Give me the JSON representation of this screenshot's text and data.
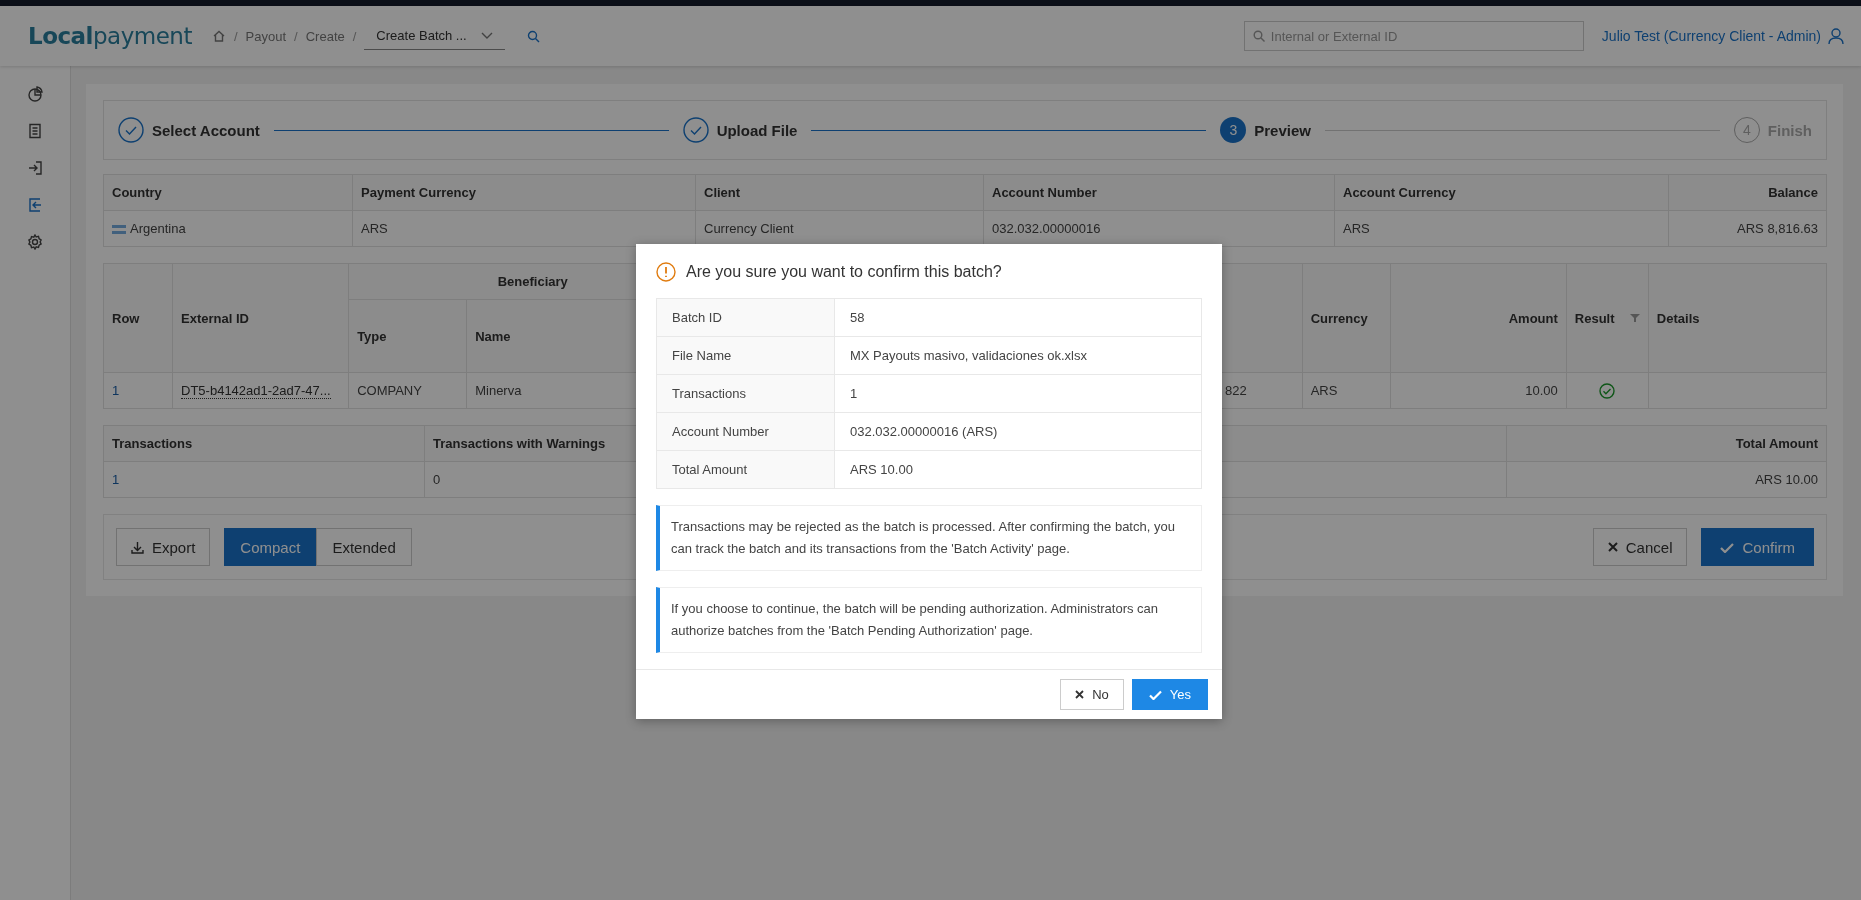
{
  "header": {
    "logo": "**Local**payment",
    "breadcrumb": [
      {
        "separator": "/",
        "label": "Payout"
      },
      {
        "separator": "/",
        "label": "Create"
      }
    ],
    "trailing_separator": "/",
    "page_select": "Create Batch ...",
    "search": {
      "placeholder": "Internal or External ID"
    },
    "user": "Julio Test (Currency Client - Admin)"
  },
  "sidebar": {
    "items": [
      {
        "selected": false
      },
      {
        "selected": false
      },
      {
        "selected": false
      },
      {
        "selected": true
      },
      {
        "selected": false
      }
    ]
  },
  "steps": [
    {
      "label": "Select Account",
      "kind": "done"
    },
    {
      "label": "Upload File",
      "kind": "done"
    },
    {
      "label": "Preview",
      "kind": "current",
      "number": "3"
    },
    {
      "label": "Finish",
      "kind": "pending",
      "number": "4"
    }
  ],
  "account_table": {
    "columns": [
      "Country",
      "Payment Currency",
      "Client",
      "Account Number",
      "Account Currency",
      "Balance"
    ],
    "rows": [
      [
        "Argentina",
        "ARS",
        "Currency Client",
        "032.032.00000016",
        "ARS",
        "ARS 8,816.63"
      ]
    ]
  },
  "transactions_table": {
    "group_header": "Beneficiary",
    "columns": [
      "Row",
      "External ID",
      "Type",
      "Name",
      "",
      "Currency",
      "Amount",
      "Result",
      "Details"
    ],
    "rows": [
      {
        "row": "1",
        "external_id": "DT5-b4142ad1-2ad7-47...",
        "type": "COMPANY",
        "name": "Minerva",
        "column_5": "822",
        "currency": "ARS",
        "amount": "10.00",
        "valid": true,
        "details": ""
      }
    ]
  },
  "summary_table": {
    "columns": [
      "Transactions",
      "Transactions with Warnings",
      "Total Amount"
    ],
    "rows": [
      [
        "1",
        "0",
        "ARS 10.00"
      ]
    ]
  },
  "actions": {
    "export": "Export",
    "view_modes": [
      {
        "label": "Compact",
        "selected": true
      },
      {
        "label": "Extended",
        "selected": false
      }
    ],
    "cancel": "Cancel",
    "confirm": "Confirm"
  },
  "dialog": {
    "title": "Are you sure you want to confirm this batch?",
    "details": [
      {
        "label": "Batch ID",
        "value": "58"
      },
      {
        "label": "File Name",
        "value": "MX Payouts masivo, validaciones ok.xlsx"
      },
      {
        "label": "Transactions",
        "value": "1"
      },
      {
        "label": "Account Number",
        "value": "032.032.00000016 (ARS)"
      },
      {
        "label": "Total Amount",
        "value": "ARS 10.00"
      }
    ],
    "notes": [
      "Transactions may be rejected as the batch is processed. After confirming the batch, you can track the batch and its transactions from the 'Batch Activity' page.",
      "If you choose to continue, the batch will be pending authorization. Administrators can authorize batches from the 'Batch Pending Authorization' page."
    ],
    "no": "No",
    "yes": "Yes"
  }
}
